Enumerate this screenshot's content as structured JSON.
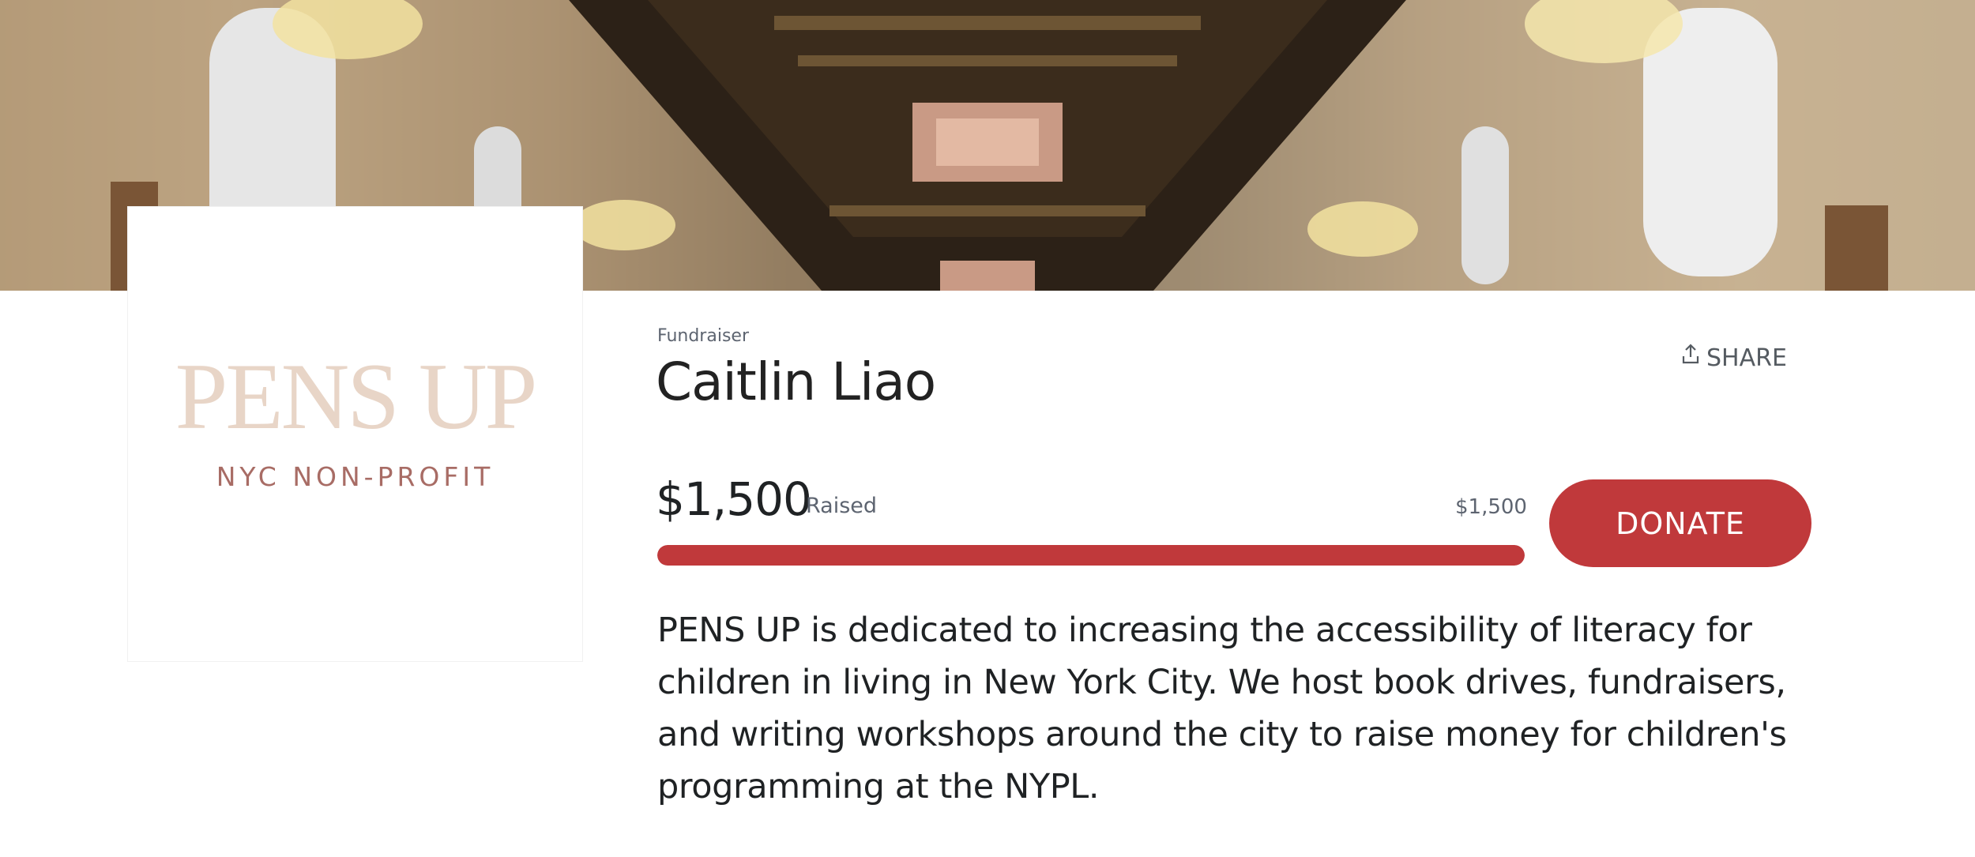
{
  "logo": {
    "name": "PENS UP",
    "tagline": "NYC NON-PROFIT"
  },
  "header": {
    "eyebrow": "Fundraiser",
    "title": "Caitlin Liao",
    "share_label": "SHARE"
  },
  "fundraising": {
    "raised_amount": "$1,500",
    "raised_label": "Raised",
    "goal_amount": "$1,500",
    "progress_fraction": 1.0,
    "donate_label": "DONATE"
  },
  "description": "PENS UP is dedicated to increasing the accessibility of literacy for children in living in New York City. We host book drives, fundraisers, and writing workshops around the city to raise money for children's programming at the NYPL.",
  "colors": {
    "accent": "#c0393b",
    "logo_primary": "#e8d5c7",
    "logo_secondary": "#a86c65"
  },
  "icons": {
    "share": "share-upload-icon"
  }
}
